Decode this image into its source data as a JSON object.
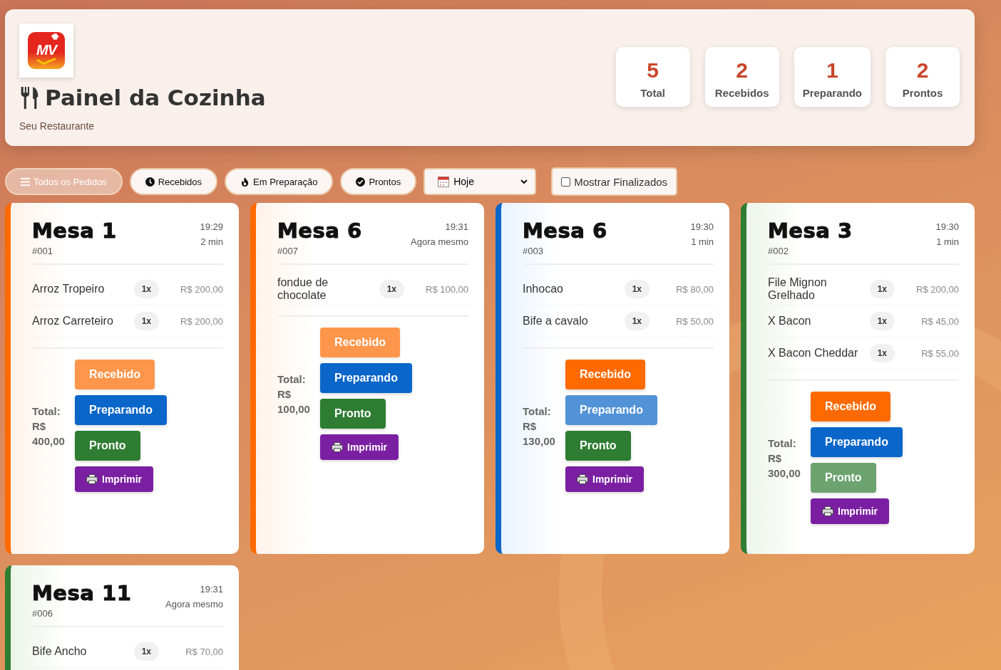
{
  "header": {
    "logo_text": "MV",
    "title": "Painel da Cozinha",
    "subtitle": "Seu Restaurante"
  },
  "stats": [
    {
      "value": "5",
      "label": "Total"
    },
    {
      "value": "2",
      "label": "Recebidos"
    },
    {
      "value": "1",
      "label": "Preparando"
    },
    {
      "value": "2",
      "label": "Prontos"
    }
  ],
  "filters": [
    {
      "label": "Todos os Pedidos",
      "kind": "all",
      "selected": true
    },
    {
      "label": "Recebidos",
      "kind": "received",
      "selected": false
    },
    {
      "label": "Em Preparação",
      "kind": "preparing",
      "selected": false
    },
    {
      "label": "Prontos",
      "kind": "ready",
      "selected": false
    }
  ],
  "date_select": {
    "value": "Hoje"
  },
  "show_finished": {
    "label": "Mostrar Finalizados",
    "checked": false
  },
  "orders": [
    {
      "table": "Mesa 1",
      "number": "#001",
      "time": "19:29",
      "elapsed": "2 min",
      "kind": "received",
      "items": [
        {
          "name": "Arroz Tropeiro",
          "qty": "1x",
          "price": "R$ 200,00"
        },
        {
          "name": "Arroz Carreteiro",
          "qty": "1x",
          "price": "R$ 200,00"
        }
      ],
      "total_label": "Total:",
      "total": "R$ 400,00",
      "actions": [
        "Recebido",
        "Preparando",
        "Pronto"
      ],
      "print": "Imprimir"
    },
    {
      "table": "Mesa 6",
      "number": "#007",
      "time": "19:31",
      "elapsed": "Agora mesmo",
      "kind": "received",
      "items": [
        {
          "name": "fondue de chocolate",
          "qty": "1x",
          "price": "R$ 100,00"
        }
      ],
      "total_label": "Total:",
      "total": "R$ 100,00",
      "actions": [
        "Recebido",
        "Preparando",
        "Pronto"
      ],
      "print": "Imprimir"
    },
    {
      "table": "Mesa 6",
      "number": "#003",
      "time": "19:30",
      "elapsed": "1 min",
      "kind": "preparing",
      "items": [
        {
          "name": "Inhocao",
          "qty": "1x",
          "price": "R$ 80,00"
        },
        {
          "name": "Bife a cavalo",
          "qty": "1x",
          "price": "R$ 50,00"
        }
      ],
      "total_label": "Total:",
      "total": "R$ 130,00",
      "actions": [
        "Recebido",
        "Preparando",
        "Pronto"
      ],
      "print": "Imprimir"
    },
    {
      "table": "Mesa 3",
      "number": "#002",
      "time": "19:30",
      "elapsed": "1 min",
      "kind": "ready",
      "items": [
        {
          "name": "File Mignon Grelhado",
          "qty": "1x",
          "price": "R$ 200,00"
        },
        {
          "name": "X Bacon",
          "qty": "1x",
          "price": "R$ 45,00"
        },
        {
          "name": "X Bacon Cheddar",
          "qty": "1x",
          "price": "R$ 55,00"
        }
      ],
      "total_label": "Total:",
      "total": "R$ 300,00",
      "actions": [
        "Recebido",
        "Preparando",
        "Pronto"
      ],
      "print": "Imprimir"
    },
    {
      "table": "Mesa 11",
      "number": "#006",
      "time": "19:31",
      "elapsed": "Agora mesmo",
      "kind": "ready",
      "items": [
        {
          "name": "Bife Ancho",
          "qty": "1x",
          "price": "R$ 70,00"
        }
      ]
    }
  ]
}
